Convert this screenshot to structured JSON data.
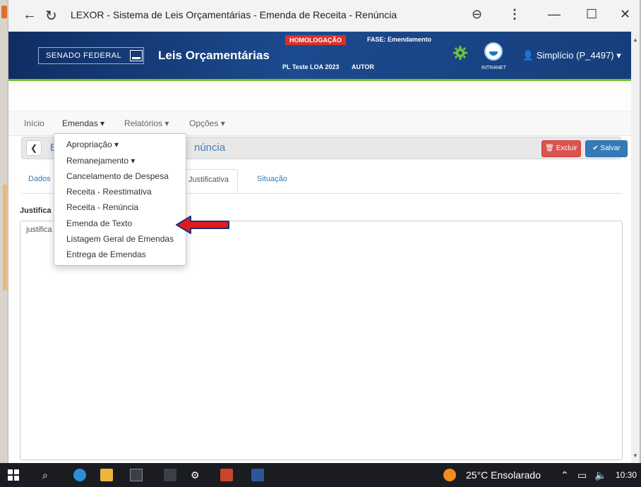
{
  "browser": {
    "title": "LEXOR - Sistema de Leis Orçamentárias - Emenda de Receita - Renúncia"
  },
  "header": {
    "org": "SENADO FEDERAL",
    "app_title": "Leis Orçamentárias",
    "env_badge": "HOMOLOGAÇÃO",
    "fase": "FASE: Emendamento",
    "pl": "PL Teste LOA 2023",
    "autor": "AUTOR",
    "intranet": "INTRANET",
    "user": "Simplício (P_4497)"
  },
  "nav": {
    "inicio": "Início",
    "emendas": "Emendas",
    "relatorios": "Relatórios",
    "opcoes": "Opções"
  },
  "dropdown": {
    "items": [
      "Apropriação",
      "Remanejamento",
      "Cancelamento de Despesa",
      "Receita - Reestimativa",
      "Receita - Renúncia",
      "Emenda de Texto",
      "Listagem Geral de Emendas",
      "Entrega de Emendas"
    ]
  },
  "panel": {
    "title_left": "E",
    "title_right": "núncia",
    "excluir": "Excluir",
    "salvar": "Salvar"
  },
  "tabs": {
    "dados": "Dados",
    "justificativa": "Justificativa",
    "situacao": "Situação"
  },
  "form": {
    "label": "Justifica",
    "value": "justifica"
  },
  "taskbar": {
    "weather": "25°C  Ensolarado",
    "time": "10:30"
  },
  "colors": {
    "header_blue": "#163e7b",
    "accent_green": "#7bbf2a",
    "danger": "#d9534f",
    "primary": "#337ab7",
    "arrow_red": "#e01b1b"
  }
}
